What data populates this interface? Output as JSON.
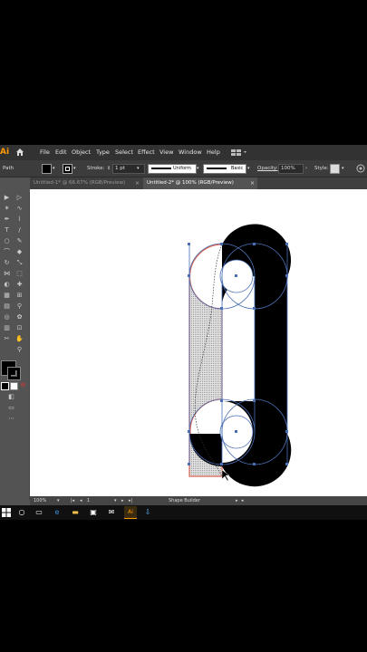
{
  "app": {
    "logo": "Ai"
  },
  "menu": [
    "File",
    "Edit",
    "Object",
    "Type",
    "Select",
    "Effect",
    "View",
    "Window",
    "Help"
  ],
  "control": {
    "selection_label": "Path",
    "stroke_label": "Stroke:",
    "stroke_value": "1 pt",
    "profile": "Uniform",
    "brush": "Basic",
    "opacity_label": "Opacity:",
    "opacity_value": "100%",
    "style_label": "Style:"
  },
  "tabs": [
    {
      "label": "Untitled-1* @ 66.67% (RGB/Preview)",
      "active": false
    },
    {
      "label": "Untitled-2* @ 100% (RGB/Preview)",
      "active": true
    }
  ],
  "status": {
    "zoom": "100%",
    "artboard": "1",
    "tool": "Shape Builder"
  },
  "colors": {
    "fill": "#000000",
    "stroke": "#000000",
    "selection": "#4a6fb5",
    "highlight": "#e06a5a",
    "accent": "#ff9a00"
  }
}
